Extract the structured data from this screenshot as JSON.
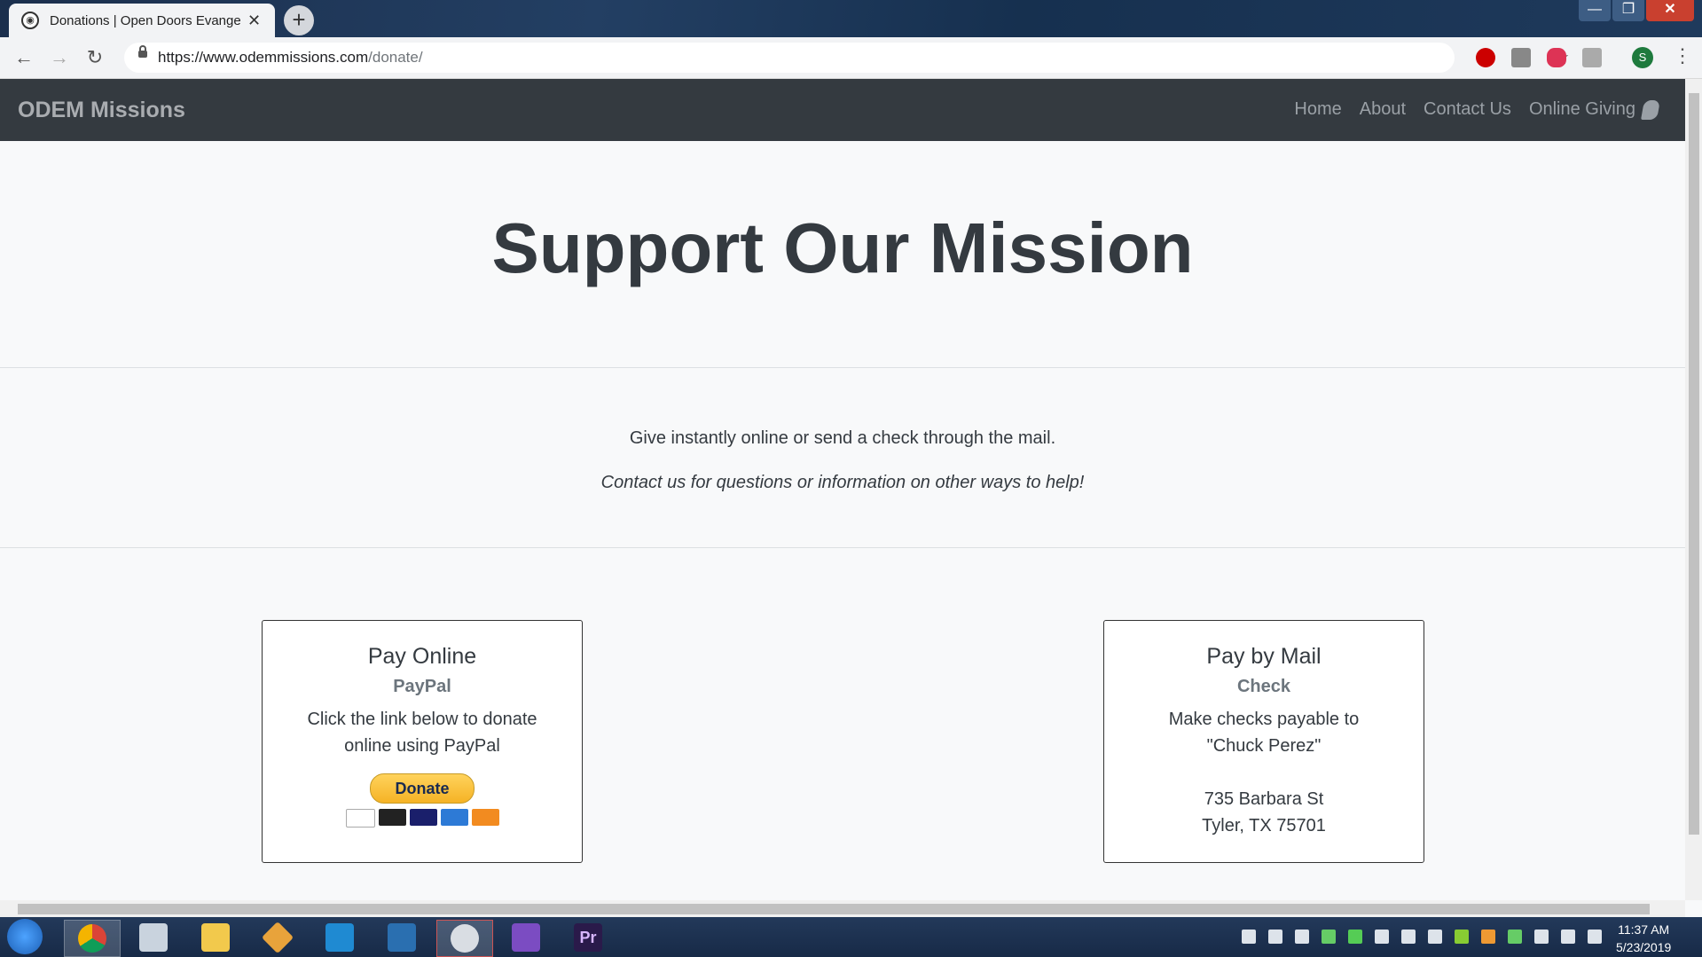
{
  "browser": {
    "tab_title": "Donations | Open Doors Evangel",
    "tab_close": "✕",
    "new_tab": "+",
    "url_host": "https://www.odemmissions.com",
    "url_path": "/donate/",
    "profile_initial": "S",
    "window_min": "—",
    "window_max": "❐",
    "window_close": "✕"
  },
  "navbar": {
    "brand": "ODEM Missions",
    "links": [
      "Home",
      "About",
      "Contact Us",
      "Online Giving"
    ]
  },
  "hero": {
    "title": "Support Our Mission"
  },
  "intro": {
    "line1": "Give instantly online or send a check through the mail.",
    "line2": "Contact us for questions or information on other ways to help!"
  },
  "cards": {
    "online": {
      "title": "Pay Online",
      "subtitle": "PayPal",
      "text_line1": "Click the link below to donate",
      "text_line2": "online using PayPal",
      "button": "Donate"
    },
    "mail": {
      "title": "Pay by Mail",
      "subtitle": "Check",
      "text_line1": "Make checks payable to",
      "text_line2": "\"Chuck Perez\"",
      "address_line1": "735 Barbara St",
      "address_line2": "Tyler, TX 75701"
    }
  },
  "taskbar": {
    "time": "11:37 AM",
    "date": "5/23/2019",
    "apps": [
      "chrome-icon",
      "calculator-icon",
      "file-explorer-icon",
      "git-icon",
      "vscode-icon",
      "powershell-icon",
      "snipping-tool-icon",
      "visual-studio-icon",
      "premiere-icon"
    ],
    "premiere_label": "Pr"
  },
  "colors": {
    "navbar_bg": "#343a40",
    "page_bg": "#f8f9fa",
    "heading": "#343a40",
    "muted": "#6c757d",
    "donate_button": "#f5b325"
  }
}
